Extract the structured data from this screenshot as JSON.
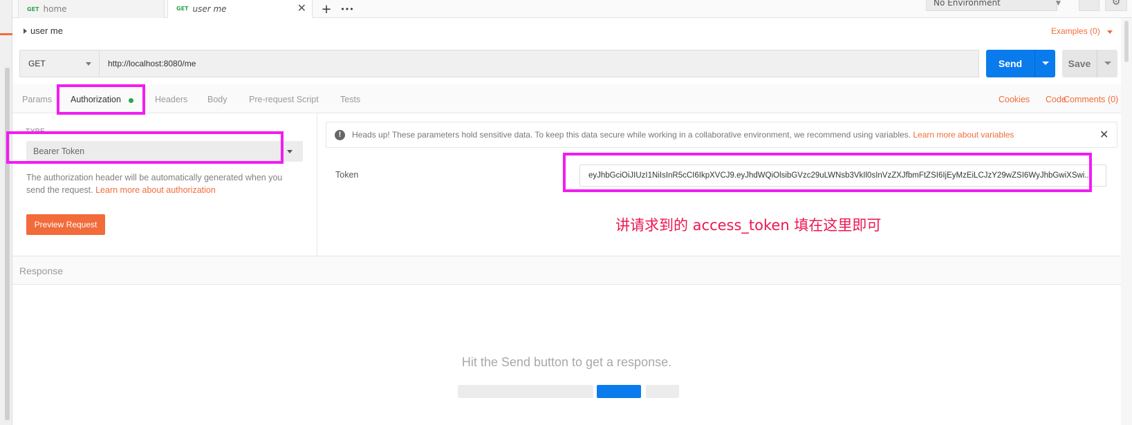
{
  "tabs": [
    {
      "method": "GET",
      "title": "home",
      "active": false
    },
    {
      "method": "GET",
      "title": "user me",
      "active": true
    }
  ],
  "toolbar": {
    "new_tab_glyph": "+",
    "more_glyph": "•••",
    "close_glyph": "✕",
    "environment": "No Environment"
  },
  "request": {
    "name": "user me",
    "examples_label": "Examples (0)",
    "method": "GET",
    "url": "http://localhost:8080/me",
    "send_label": "Send",
    "save_label": "Save"
  },
  "request_tabs": [
    {
      "label": "Params",
      "active": false
    },
    {
      "label": "Authorization",
      "active": true
    },
    {
      "label": "Headers",
      "active": false
    },
    {
      "label": "Body",
      "active": false
    },
    {
      "label": "Pre-request Script",
      "active": false
    },
    {
      "label": "Tests",
      "active": false
    }
  ],
  "right_links": {
    "cookies": "Cookies",
    "code": "Code",
    "comments": "Comments (0)"
  },
  "auth": {
    "type_label": "TYPE",
    "type_value": "Bearer Token",
    "description": "The authorization header will be automatically generated when you send the request.",
    "description_link": "Learn more about authorization",
    "preview_button": "Preview Request",
    "alert_text": "Heads up! These parameters hold sensitive data. To keep this data secure while working in a collaborative environment, we recommend using variables.",
    "alert_link": "Learn more about variables",
    "alert_icon_glyph": "!",
    "token_label": "Token",
    "token_value": "eyJhbGciOiJIUzI1NiIsInR5cCI6IkpXVCJ9.eyJhdWQiOlsibGVzc29uLWNsb3VkIl0sInVzZXJfbmFtZSI6IjEyMzEiLCJzY29wZSI6WyJhbGwiXSwi..."
  },
  "annotation": {
    "note": "讲请求到的 access_token 填在这里即可",
    "highlight_color": "#f21cf2",
    "note_color": "#ee1650"
  },
  "response": {
    "label": "Response",
    "empty_message": "Hit the Send button to get a response."
  },
  "colors": {
    "accent": "#f26b3a",
    "send_blue": "#097bed",
    "get_green": "#2ea44f"
  }
}
